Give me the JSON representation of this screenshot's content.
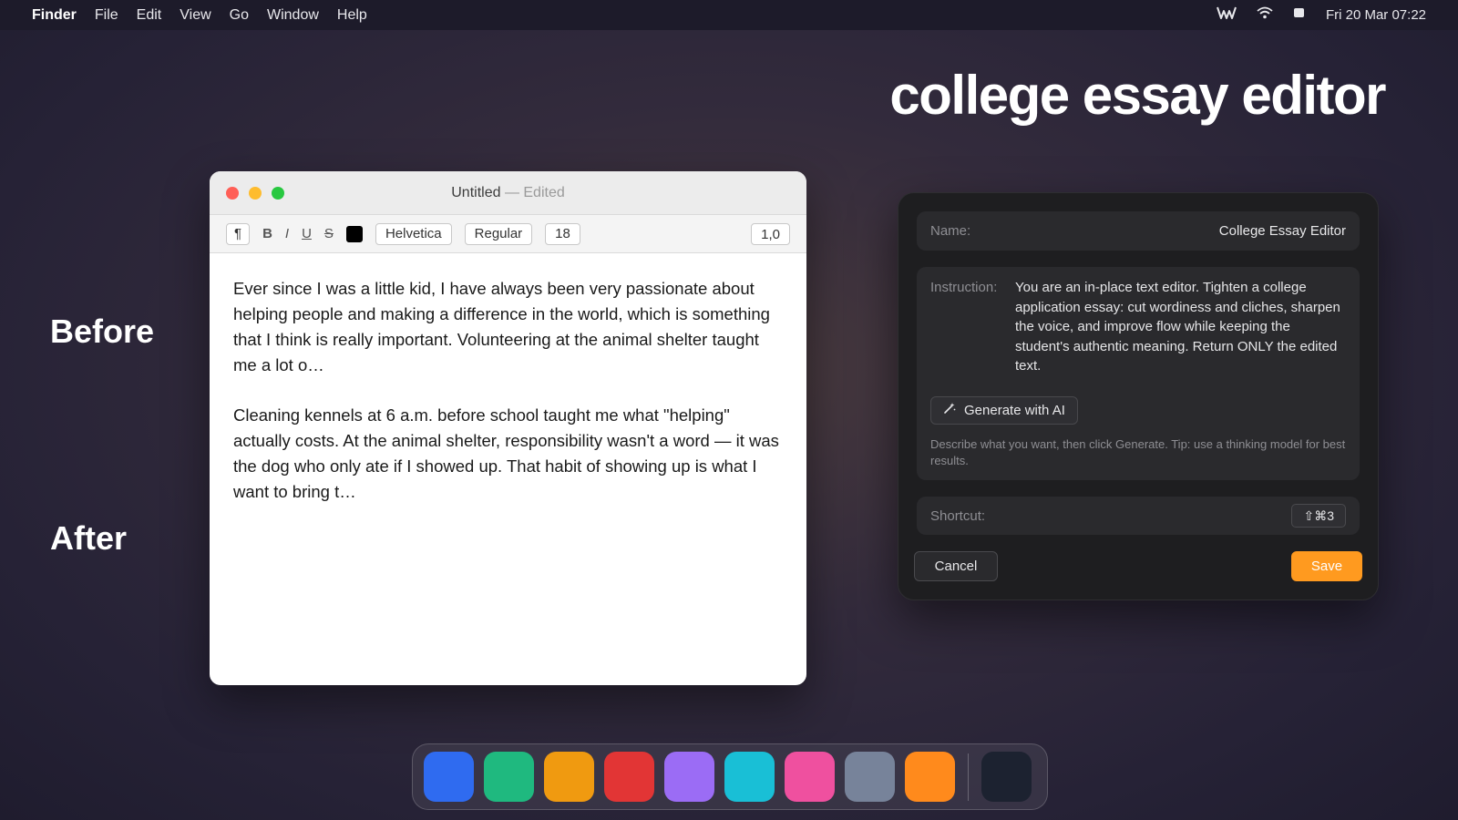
{
  "menubar": {
    "app": "Finder",
    "menus": [
      "File",
      "Edit",
      "View",
      "Go",
      "Window",
      "Help"
    ],
    "clock": "Fri 20 Mar  07:22"
  },
  "hero": {
    "title": "college essay editor"
  },
  "labels": {
    "before": "Before",
    "after": "After"
  },
  "editor": {
    "title": "Untitled",
    "status": "— Edited",
    "toolbar": {
      "paragraph": "¶",
      "bold": "B",
      "italic": "I",
      "underline": "U",
      "strike": "S",
      "text_color": "#000000",
      "font": "Helvetica",
      "style": "Regular",
      "size": "18",
      "spacing": "1,0"
    },
    "paragraphs": [
      "Ever since I was a little kid, I have always been very passionate about helping people and making a difference in the world, which is something that I think is really important. Volunteering at the animal shelter taught me a lot o…",
      "Cleaning kennels at 6 a.m. before school taught me what \"helping\" actually costs. At the animal shelter, responsibility wasn't a word — it was the dog who only ate if I showed up. That habit of showing up is what I want to bring t…"
    ]
  },
  "panel": {
    "name_label": "Name:",
    "name_value": "College Essay Editor",
    "instruction_label": "Instruction:",
    "instruction_text": "You are an in-place text editor. Tighten a college application essay: cut wordiness and cliches, sharpen the voice, and improve flow while keeping the student's authentic meaning. Return ONLY the edited text.",
    "generate_label": "Generate with AI",
    "hint": "Describe what you want, then click Generate. Tip: use a thinking model for best results.",
    "shortcut_label": "Shortcut:",
    "shortcut_value": "⇧⌘3",
    "cancel_label": "Cancel",
    "save_label": "Save",
    "accent_color": "#ff9a1f"
  },
  "dock": {
    "icons": [
      {
        "name": "blue-app-icon",
        "color": "#2f6bf0"
      },
      {
        "name": "green-app-icon",
        "color": "#1fb97f"
      },
      {
        "name": "amber-app-icon",
        "color": "#f09a10"
      },
      {
        "name": "red-app-icon",
        "color": "#e23535"
      },
      {
        "name": "purple-app-icon",
        "color": "#9b6cf5"
      },
      {
        "name": "cyan-app-icon",
        "color": "#19bfd6"
      },
      {
        "name": "pink-app-icon",
        "color": "#ef509f"
      },
      {
        "name": "gray-app-icon",
        "color": "#77839a"
      },
      {
        "name": "orange-app-icon",
        "color": "#ff8a1c"
      }
    ],
    "trailing_icon": {
      "name": "dark-app-icon",
      "color": "#1c2230"
    }
  }
}
